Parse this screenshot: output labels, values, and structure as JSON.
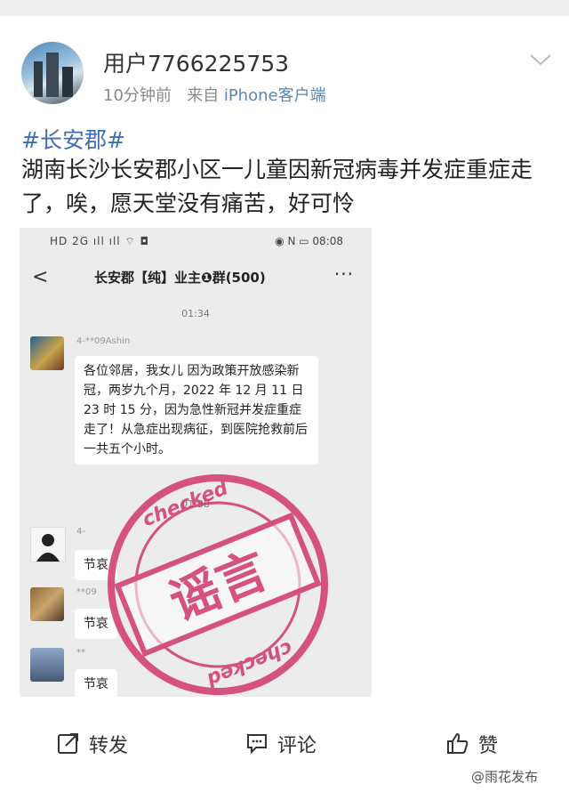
{
  "post": {
    "username": "用户7766225753",
    "time_ago": "10分钟前",
    "from_prefix": "来自",
    "source": "iPhone客户端",
    "hashtag": "#长安郡#",
    "content": "湖南长沙长安郡小区一儿童因新冠病毒并发症重症走了，唉，愿天堂没有痛苦，好可怜"
  },
  "screenshot": {
    "status_left": "HD 2G ıll ıll ⌔ ◘",
    "status_time": "08:08",
    "status_right_icons": "◉ N ▭",
    "chat_title": "长安郡【纯】业主❶群(500)",
    "back_glyph": "<",
    "more_glyph": "···",
    "time1": "01:34",
    "sender1": "4-**09Ashin",
    "message1": "各位邻居，我女儿 因为政策开放感染新冠，两岁九个月，2022 年 12 月 11 日 23 时 15 分，因为急性新冠并发症重症走了！从急症出现病征，到医院抢救前后一共五个小时。",
    "time2": "01:38",
    "sender2": "4-",
    "message2": "节哀",
    "sender3": "**09",
    "message3": "节哀",
    "sender4": "**",
    "message4": "节哀",
    "stamp_text": "谣言",
    "stamp_ring_text": "checked",
    "stamp_color": "#d0386a"
  },
  "actions": {
    "repost": "转发",
    "comment": "评论",
    "like": "赞"
  },
  "watermark": "@雨花发布"
}
